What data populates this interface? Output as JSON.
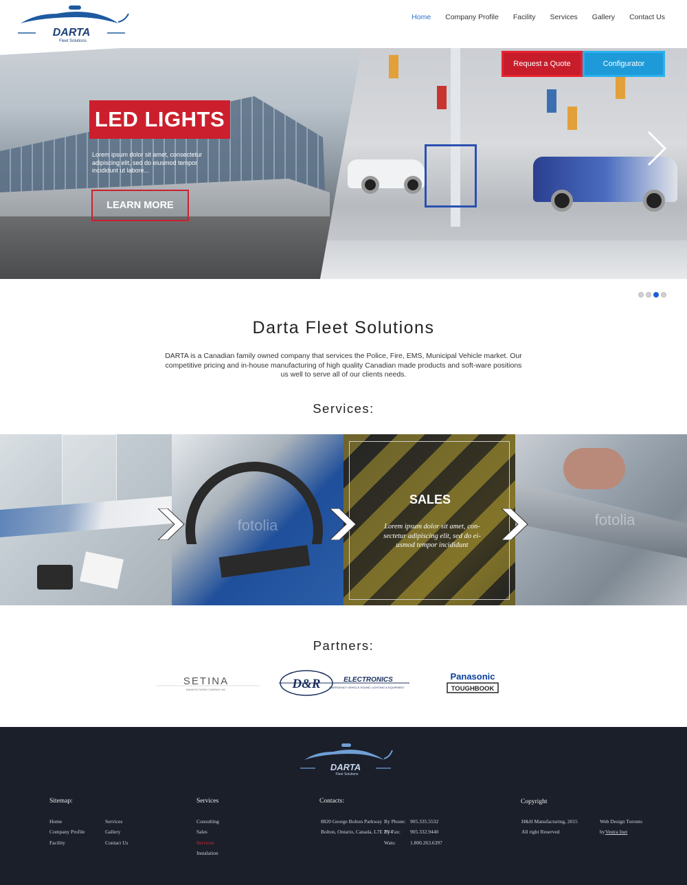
{
  "brand": {
    "name": "DARTA",
    "tagline": "Fleet Solutions"
  },
  "nav": {
    "items": [
      "Home",
      "Company Profile",
      "Facility",
      "Services",
      "Gallery",
      "Contact Us"
    ],
    "active": "Home"
  },
  "hero": {
    "title": "LED LIGHTS",
    "text": "Lorem ipsum dolor sit amet, consectetur adipiscing elit, sed do eiusmod tempor incididunt ut labore...",
    "button": "LEARN MORE",
    "request_quote": "Request a Quote",
    "configurator": "Configurator",
    "slide_count": 4,
    "active_slide": 3
  },
  "about": {
    "title": "Darta Fleet Solutions",
    "text": "DARTA is a Canadian family owned company that services the Police, Fire, EMS, Municipal Vehicle market. Our competitive pricing and in-house manufacturing of high quality Canadian made products and soft-ware positions us well to serve all of our clients needs."
  },
  "services": {
    "title": "Services:",
    "active": {
      "title": "SALES",
      "text": "Lorem ipsum dolor sit amet, con-sectetur adipiscing elit, sed do ei-usmod tempor incididunt"
    },
    "watermark": "fotolia"
  },
  "partners": {
    "title": "Partners:",
    "setina": {
      "name": "SETINA",
      "sub": "MANUFACTURING COMPANY INC."
    },
    "dr": {
      "mark": "D&R",
      "name": "ELECTRONICS",
      "sub": "EMERGENCY VEHICLE SOUND, LIGHTING & EQUIPMENT"
    },
    "panasonic": {
      "name": "Panasonic",
      "sub": "TOUGHBOOK"
    }
  },
  "footer": {
    "sitemap_title": "Sitemap:",
    "sitemap_col1": [
      "Home",
      "Company Profile",
      "Facility"
    ],
    "sitemap_col2": [
      "Services",
      "Gallery",
      "Contact Us"
    ],
    "services_title": "Services",
    "services_items": [
      "Consulting",
      "Sales",
      "Services",
      "Instalation"
    ],
    "services_active": "Services",
    "contacts_title": "Contacts:",
    "address_line1": "8820 George Bolton Parkway",
    "address_line2": "Bolton, Ontario, Canada, L7E 2Y4",
    "phone_label": "By Phone:",
    "phone": "905.335.5532",
    "fax_label": "By Fax:",
    "fax": "905.332.9440",
    "wats_label": "Wats:",
    "wats": "1.800.263.6397",
    "copyright_title": "Copyright",
    "copyright_line1": "H&H Manufacturing, 2015",
    "copyright_line2": "All right Reserved",
    "design_line1": "Web Design Toronto",
    "design_by": "by",
    "design_link": "Vestra Inet"
  },
  "colors": {
    "accent_red": "#cc1f2d",
    "accent_blue": "#1e9ad8",
    "nav_active": "#2a6fd0",
    "footer_bg": "#1b1f2a"
  }
}
